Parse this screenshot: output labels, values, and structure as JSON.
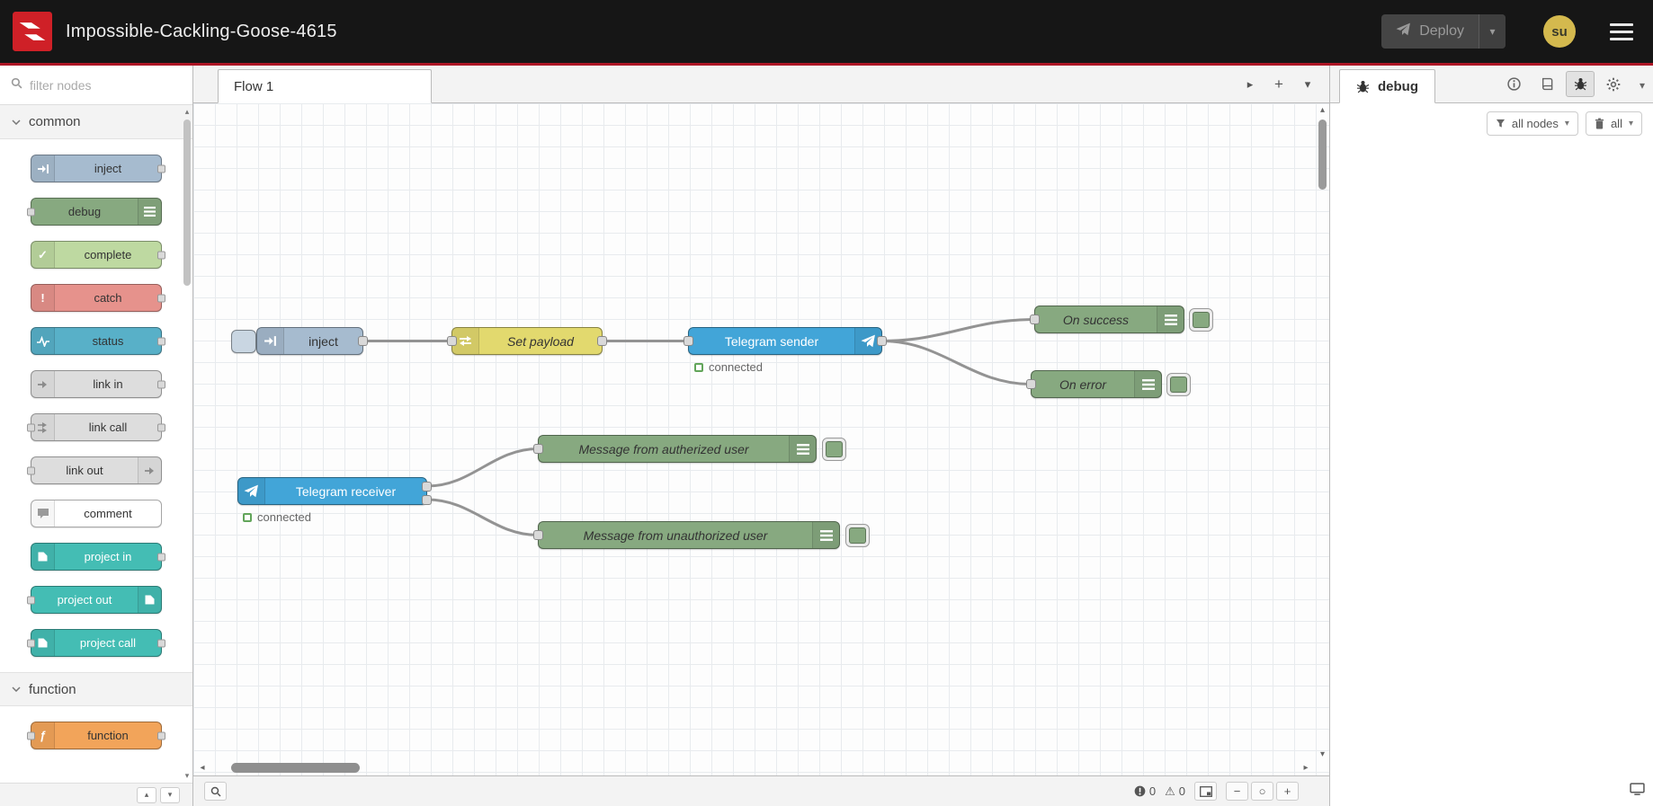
{
  "icons": {
    "plus": "+",
    "minus": "−",
    "zoom_reset": "○",
    "warning": "⚠",
    "chev_down": "▾",
    "chev_right": "▸",
    "chev_up": "▴",
    "chev_left": "◂",
    "exclaim": "!",
    "check": "✓",
    "fn": "ƒ"
  },
  "colors": {
    "header_bg": "#161616",
    "header_accent": "#ad1625",
    "wire": "#939393",
    "node_telegram": "#42a5d8",
    "node_change": "#e2d96e",
    "node_debug_green": "#87a980"
  },
  "header": {
    "title": "Impossible-Cackling-Goose-4615",
    "deploy_label": "Deploy",
    "user_initials": "su"
  },
  "palette": {
    "filter_placeholder": "filter nodes",
    "categories": [
      {
        "label": "common"
      },
      {
        "label": "function"
      }
    ],
    "items": [
      {
        "label": "inject",
        "color": "#a6bbcf"
      },
      {
        "label": "debug",
        "color": "#87a980"
      },
      {
        "label": "complete",
        "color": "#bed9a1"
      },
      {
        "label": "catch",
        "color": "#e6928c"
      },
      {
        "label": "status",
        "color": "#58b0c8"
      },
      {
        "label": "link in",
        "color": "#dddddd"
      },
      {
        "label": "link call",
        "color": "#dddddd"
      },
      {
        "label": "link out",
        "color": "#dddddd"
      },
      {
        "label": "comment",
        "color": "#ffffff"
      },
      {
        "label": "project in",
        "color": "#44bdb4"
      },
      {
        "label": "project out",
        "color": "#44bdb4"
      },
      {
        "label": "project call",
        "color": "#44bdb4"
      },
      {
        "label": "function",
        "color": "#f2a45a"
      }
    ]
  },
  "workspace": {
    "tab_label": "Flow 1",
    "nodes": [
      {
        "label": "inject",
        "color": "#a6bbcf",
        "button_color": "#c9d6e2"
      },
      {
        "label": "Set payload",
        "color": "#e2d96e"
      },
      {
        "label": "Telegram sender",
        "color": "#42a5d8",
        "status": "connected"
      },
      {
        "label": "On success",
        "color": "#87a980"
      },
      {
        "label": "On error",
        "color": "#87a980"
      },
      {
        "label": "Telegram receiver",
        "color": "#42a5d8",
        "status": "connected"
      },
      {
        "label": "Message from autherized user",
        "color": "#87a980"
      },
      {
        "label": "Message from unauthorized user",
        "color": "#87a980"
      }
    ],
    "footer": {
      "error_count": "0",
      "warning_count": "0"
    }
  },
  "debug_panel": {
    "tab_label": "debug",
    "filter_button": "all nodes",
    "clear_button": "all"
  }
}
